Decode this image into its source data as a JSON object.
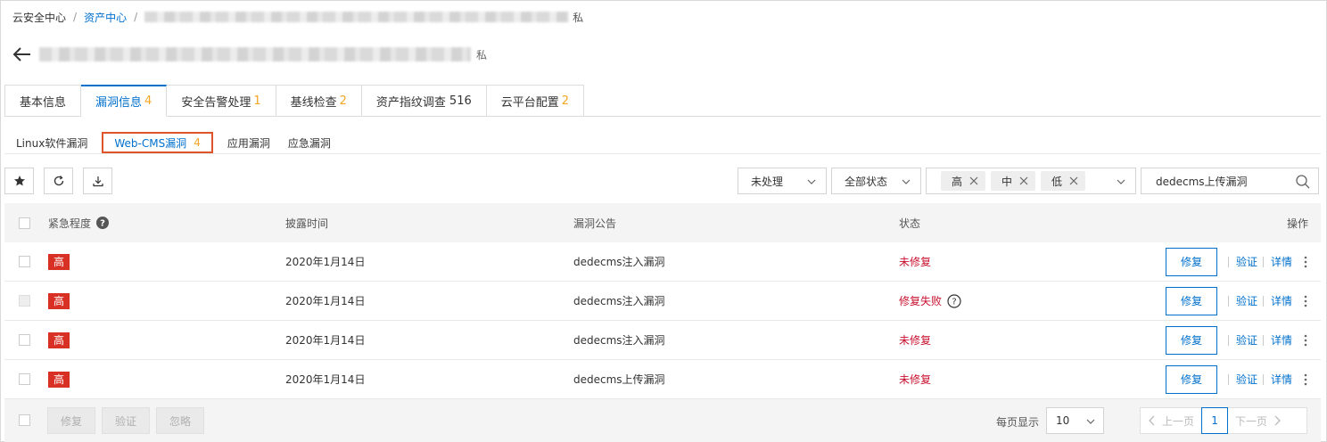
{
  "breadcrumb": {
    "home": "云安全中心",
    "assets": "资产中心",
    "sep": "/",
    "suffix": "私"
  },
  "title": {
    "suffix": "私"
  },
  "tabs": [
    {
      "label": "基本信息",
      "count": ""
    },
    {
      "label": "漏洞信息",
      "count": "4"
    },
    {
      "label": "安全告警处理",
      "count": "1"
    },
    {
      "label": "基线检查",
      "count": "2"
    },
    {
      "label": "资产指纹调查",
      "count": "516",
      "plain": true
    },
    {
      "label": "云平台配置",
      "count": "2"
    }
  ],
  "subtabs": [
    {
      "label": "Linux软件漏洞"
    },
    {
      "label": "Web-CMS漏洞",
      "count": "4"
    },
    {
      "label": "应用漏洞"
    },
    {
      "label": "应急漏洞"
    }
  ],
  "toolbar": {
    "filter_handled": "未处理",
    "filter_status": "全部状态",
    "severity_tags": [
      "高",
      "中",
      "低"
    ],
    "search_value": "dedecms上传漏洞"
  },
  "table": {
    "headers": {
      "severity": "紧急程度",
      "date": "披露时间",
      "notice": "漏洞公告",
      "status": "状态",
      "ops": "操作"
    },
    "rows": [
      {
        "severity": "高",
        "date": "2020年1月14日",
        "notice": "dedecms注入漏洞",
        "status": "未修复",
        "help": false
      },
      {
        "severity": "高",
        "date": "2020年1月14日",
        "notice": "dedecms注入漏洞",
        "status": "修复失败",
        "help": true
      },
      {
        "severity": "高",
        "date": "2020年1月14日",
        "notice": "dedecms注入漏洞",
        "status": "未修复",
        "help": false
      },
      {
        "severity": "高",
        "date": "2020年1月14日",
        "notice": "dedecms上传漏洞",
        "status": "未修复",
        "help": false
      }
    ],
    "ops": {
      "fix": "修复",
      "verify": "验证",
      "detail": "详情"
    }
  },
  "footer": {
    "fix": "修复",
    "verify": "验证",
    "ignore": "忽略",
    "page_size_label": "每页显示",
    "page_size": "10",
    "prev": "上一页",
    "page": "1",
    "next": "下一页"
  },
  "colors": {
    "accent": "#0070cc",
    "count": "#f5a623",
    "danger": "#d93026",
    "highlight_border": "#e0542c"
  }
}
